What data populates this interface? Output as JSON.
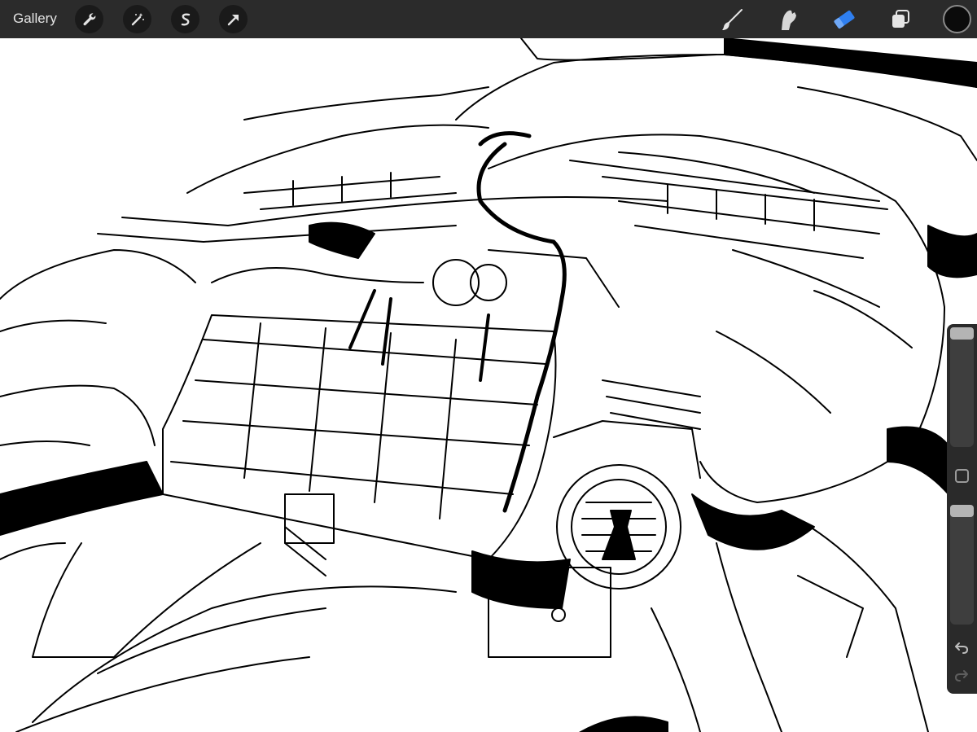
{
  "app": {
    "gallery_label": "Gallery"
  },
  "toolbar_left": [
    {
      "name": "actions-wrench-icon"
    },
    {
      "name": "adjustments-magic-wand-icon"
    },
    {
      "name": "selection-s-icon"
    },
    {
      "name": "transform-arrow-icon"
    }
  ],
  "toolbar_right": [
    {
      "name": "brush-icon"
    },
    {
      "name": "smudge-icon"
    },
    {
      "name": "eraser-icon",
      "active": true
    },
    {
      "name": "layers-icon"
    }
  ],
  "colors": {
    "topbar": "#2b2b2b",
    "active_tool": "#2f7ff0",
    "current_color": "#0b0b0b",
    "sidebar": "#2a2a2a"
  },
  "sidebar": {
    "brush_size_level": 0.0,
    "opacity_level": 0.0
  }
}
